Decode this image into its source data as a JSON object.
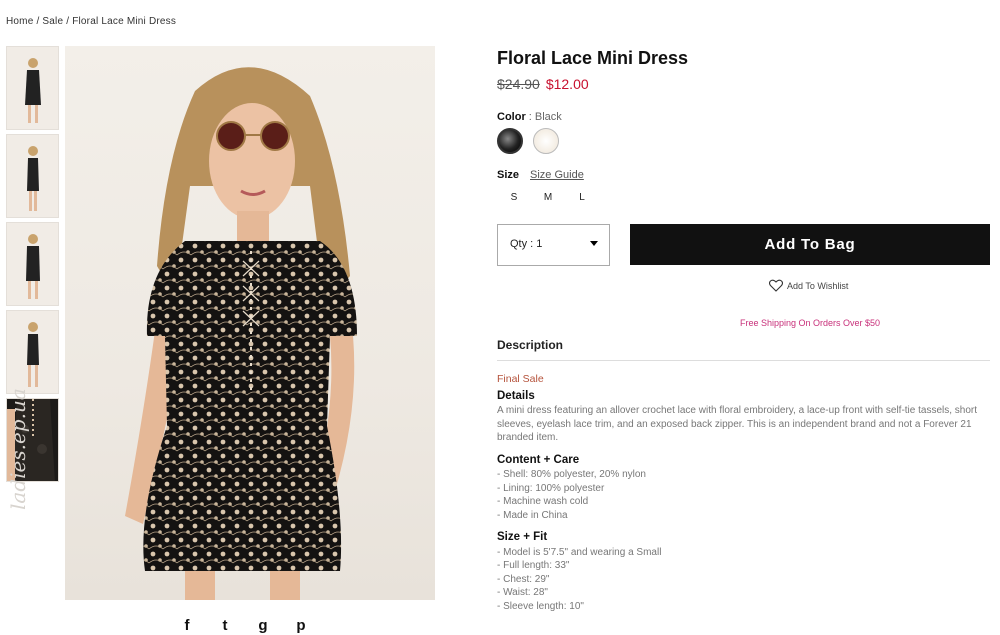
{
  "breadcrumb": {
    "home": "Home",
    "sep": " / ",
    "sale": "Sale",
    "current": "Floral Lace Mini Dress"
  },
  "product": {
    "title": "Floral Lace Mini Dress",
    "old_price": "$24.90",
    "new_price": "$12.00",
    "color_label": "Color",
    "color_sep": " : ",
    "color_value": "Black",
    "swatches": [
      "Black",
      "Cream"
    ],
    "size_label": "Size",
    "size_guide": "Size Guide",
    "sizes": [
      "S",
      "M",
      "L"
    ],
    "qty": "Qty : 1",
    "add_to_bag": "Add To Bag",
    "wishlist": "Add To Wishlist",
    "shipping": "Free Shipping On Orders Over $50"
  },
  "description": {
    "title": "Description",
    "final_sale": "Final Sale",
    "details_title": "Details",
    "details": "A mini dress featuring an allover crochet lace with floral embroidery, a lace-up front with self-tie tassels, short sleeves, eyelash lace trim, and an exposed back zipper. This is an independent brand and not a Forever 21 branded item.",
    "content_title": "Content + Care",
    "content": [
      "- Shell: 80% polyester, 20% nylon",
      "- Lining: 100% polyester",
      "- Machine wash cold",
      "- Made in China"
    ],
    "size_title": "Size + Fit",
    "size_fit": [
      "- Model is 5'7.5\" and wearing a Small",
      "- Full length: 33\"",
      "- Chest: 29\"",
      "- Waist: 28\"",
      "- Sleeve length: 10\""
    ]
  },
  "watermark": "ladies.ep.ua",
  "social": {
    "facebook": "f",
    "twitter": "t",
    "googleplus": "g",
    "pinterest": "p"
  },
  "colors": {
    "sale_red": "#c8102e",
    "shipping_pink": "#c8307a",
    "button_black": "#111111"
  }
}
